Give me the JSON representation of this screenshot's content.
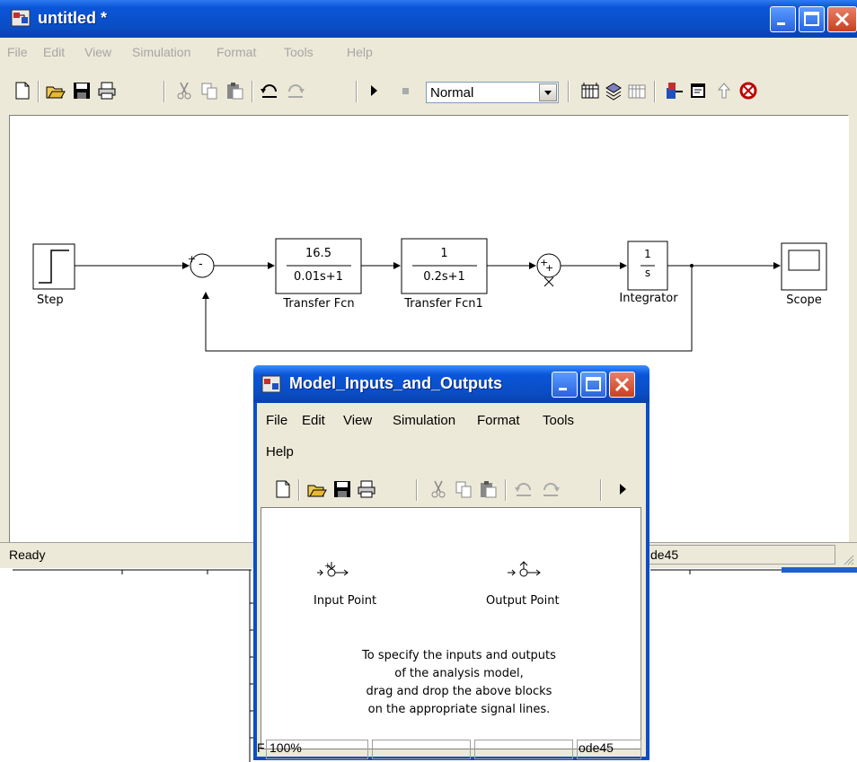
{
  "main": {
    "title": "untitled *",
    "menu": [
      "File",
      "Edit",
      "View",
      "Simulation",
      "Format",
      "Tools",
      "Help"
    ],
    "sim_mode": "Normal",
    "status": {
      "text": "Ready",
      "solver": "de45"
    }
  },
  "diagram": {
    "blocks": {
      "step": "Step",
      "tf1": {
        "num": "16.5",
        "den": "0.01s+1",
        "name": "Transfer Fcn"
      },
      "tf2": {
        "num": "1",
        "den": "0.2s+1",
        "name": "Transfer Fcn1"
      },
      "integrator": {
        "num": "1",
        "den": "s",
        "name": "Integrator"
      },
      "scope": "Scope"
    },
    "sum1_signs": [
      "+",
      "-"
    ],
    "sum2_signs": [
      "+",
      "+"
    ]
  },
  "child": {
    "title": "Model_Inputs_and_Outputs",
    "menu_row1": [
      "File",
      "Edit",
      "View",
      "Simulation",
      "Format",
      "Tools"
    ],
    "menu_row2": [
      "Help"
    ],
    "input_label": "Input Point",
    "output_label": "Output Point",
    "description": [
      "To specify the inputs and outputs",
      "of the analysis model,",
      "drag and drop the above blocks",
      "on the appropriate signal lines."
    ],
    "status": {
      "left_fragment": "F",
      "zoom": "100%",
      "solver": "ode45"
    }
  },
  "colors": {
    "title_blue": "#0a4ec6",
    "close_red": "#c8401e",
    "chrome": "#ece9d8"
  }
}
